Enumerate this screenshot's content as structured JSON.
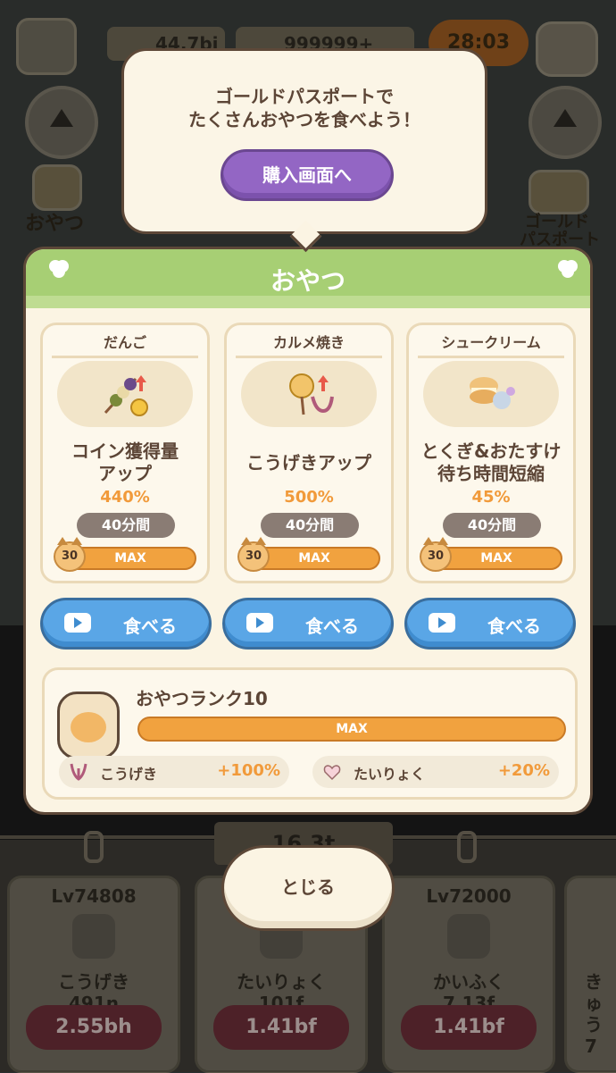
{
  "hud": {
    "coins": "44.7bi",
    "gems": "999999+",
    "timer": "28:03"
  },
  "side": {
    "left_label": "おやつ",
    "right_label_1": "ゴールド",
    "right_label_2": "パスポート"
  },
  "tooltip": {
    "line1": "ゴールドパスポートで",
    "line2": "たくさんおやつを食べよう！",
    "button": "購入画面へ"
  },
  "panel": {
    "title": "おやつ",
    "snacks": [
      {
        "name": "だんご",
        "effect_line1": "コイン獲得量",
        "effect_line2": "アップ",
        "value": "440%",
        "duration": "40分間",
        "level": "30",
        "status": "MAX",
        "button": "食べる"
      },
      {
        "name": "カルメ焼き",
        "effect_line1": "こうげきアップ",
        "effect_line2": "",
        "value": "500%",
        "duration": "40分間",
        "level": "30",
        "status": "MAX",
        "button": "食べる"
      },
      {
        "name": "シュークリーム",
        "effect_line1": "とくぎ&おたすけ",
        "effect_line2": "待ち時間短縮",
        "value": "45%",
        "duration": "40分間",
        "level": "30",
        "status": "MAX",
        "button": "食べる"
      }
    ],
    "rank": {
      "title": "おやつランク10",
      "status": "MAX",
      "bonuses": [
        {
          "label": "こうげき",
          "value": "+100%"
        },
        {
          "label": "たいりょく",
          "value": "+20%"
        }
      ]
    }
  },
  "close_button": "とじる",
  "upgrades": {
    "ribbon": "16.3t",
    "cards": [
      {
        "level": "Lv74808",
        "name": "こうげき",
        "amount": "491n",
        "price": "2.55bh"
      },
      {
        "level": "",
        "name": "たいりょく",
        "amount": "101f",
        "price": "1.41bf"
      },
      {
        "level": "Lv72000",
        "name": "かいふく",
        "amount": "7.13f",
        "price": "1.41bf"
      },
      {
        "level": "",
        "name": "きゅう",
        "amount": "7",
        "price": ""
      }
    ]
  },
  "colors": {
    "panel_header": "#a7cf74",
    "accent_orange": "#f19a3a",
    "eat_button": "#5aa6e6",
    "buy_button": "#9366c4",
    "text_brown": "#5c4536"
  }
}
